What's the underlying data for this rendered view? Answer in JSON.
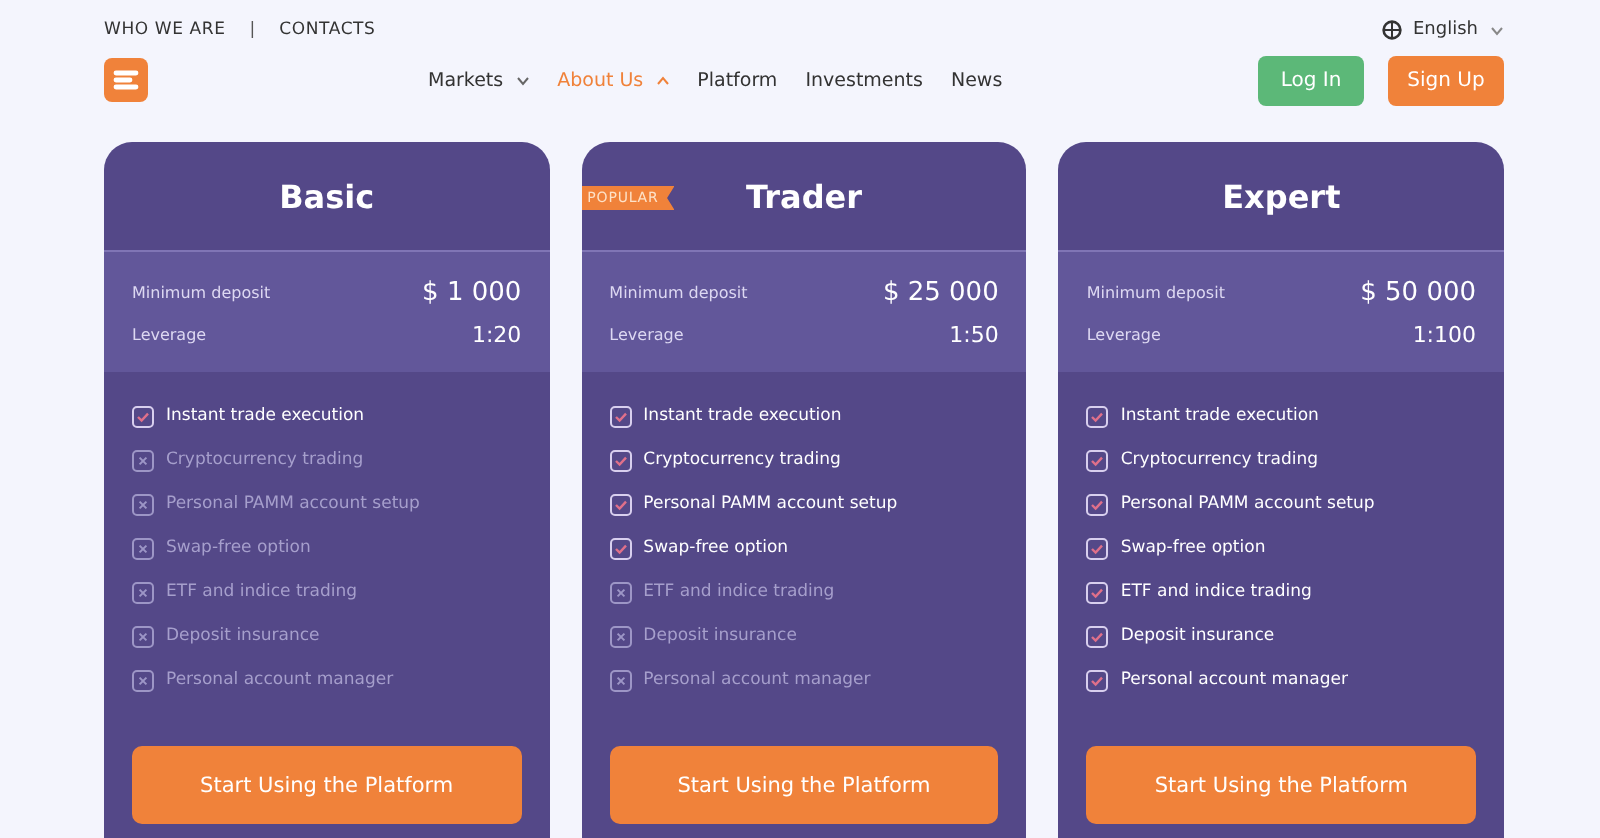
{
  "top_links": [
    "WHO WE ARE",
    "CONTACTS"
  ],
  "top_separator": "|",
  "language": {
    "label": "English",
    "expanded": false
  },
  "nav": [
    {
      "label": "Markets",
      "selected": false,
      "expanded": false
    },
    {
      "label": "About Us",
      "selected": true,
      "expanded": true
    },
    {
      "label": "Platform",
      "selected": false
    },
    {
      "label": "Investments",
      "selected": false
    },
    {
      "label": "News",
      "selected": false
    }
  ],
  "login_button": "Log In",
  "signup_button": "Sign Up",
  "plans": [
    {
      "name": "Basic",
      "deposit_label": "Minimum deposit",
      "deposit": "$ 1 000",
      "leverage_label": "Leverage",
      "leverage": "1:20",
      "button": "Start Using the Platform",
      "features": [
        {
          "label": "Instant trade execution",
          "included": true
        },
        {
          "label": "Cryptocurrency trading",
          "included": false
        },
        {
          "label": "Personal PAMM account setup",
          "included": false
        },
        {
          "label": "Swap-free option",
          "included": false
        },
        {
          "label": "ETF and indice trading",
          "included": false
        },
        {
          "label": "Deposit insurance",
          "included": false
        },
        {
          "label": "Personal account manager",
          "included": false
        }
      ]
    },
    {
      "name": "Trader",
      "badge": "POPULAR",
      "deposit_label": "Minimum deposit",
      "deposit": "$ 25 000",
      "leverage_label": "Leverage",
      "leverage": "1:50",
      "button": "Start Using the Platform",
      "features": [
        {
          "label": "Instant trade execution",
          "included": true
        },
        {
          "label": "Cryptocurrency trading",
          "included": true
        },
        {
          "label": "Personal PAMM account setup",
          "included": true
        },
        {
          "label": "Swap-free option",
          "included": true
        },
        {
          "label": "ETF and indice trading",
          "included": false
        },
        {
          "label": "Deposit insurance",
          "included": false
        },
        {
          "label": "Personal account manager",
          "included": false
        }
      ]
    },
    {
      "name": "Expert",
      "deposit_label": "Minimum deposit",
      "deposit": "$ 50 000",
      "leverage_label": "Leverage",
      "leverage": "1:100",
      "button": "Start Using the Platform",
      "features": [
        {
          "label": "Instant trade execution",
          "included": true
        },
        {
          "label": "Cryptocurrency trading",
          "included": true
        },
        {
          "label": "Personal PAMM account setup",
          "included": true
        },
        {
          "label": "Swap-free option",
          "included": true
        },
        {
          "label": "ETF and indice trading",
          "included": true
        },
        {
          "label": "Deposit insurance",
          "included": true
        },
        {
          "label": "Personal account manager",
          "included": true
        }
      ]
    }
  ]
}
